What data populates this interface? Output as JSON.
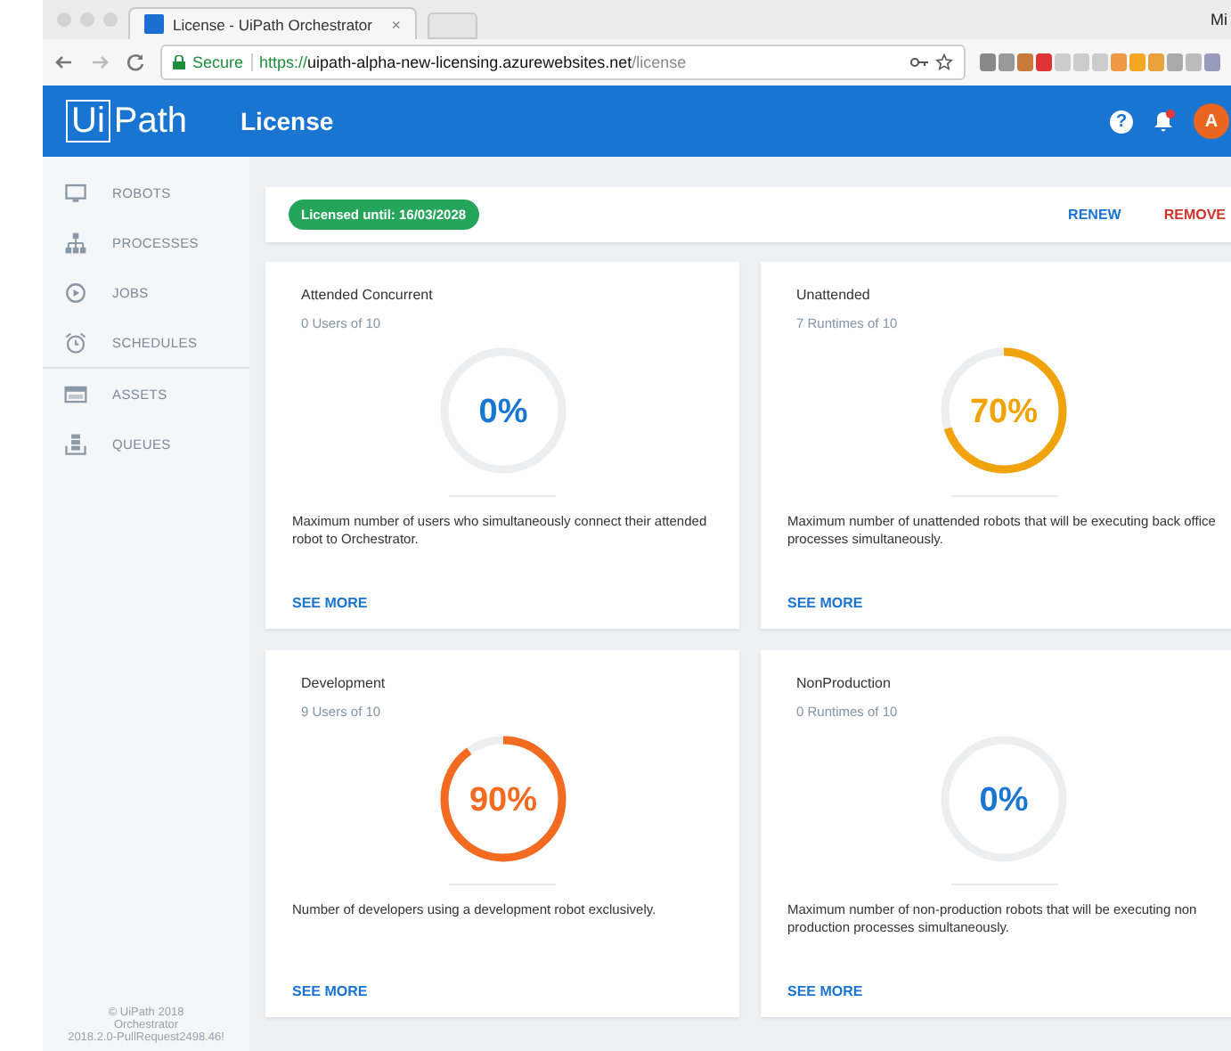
{
  "browser": {
    "tab_title": "License - UiPath Orchestrator",
    "tab_close": "×",
    "secure_label": "Secure",
    "url_scheme": "https://",
    "url_host": "uipath-alpha-new-licensing.azurewebsites.net",
    "url_path": "/license",
    "profile": "Mi"
  },
  "header": {
    "logo_left": "Ui",
    "logo_right": "Path",
    "title": "License",
    "help": "?",
    "avatar": "A",
    "notification_dot": true
  },
  "sidebar": {
    "groups": [
      {
        "items": [
          {
            "label": "ROBOTS"
          },
          {
            "label": "PROCESSES"
          },
          {
            "label": "JOBS"
          },
          {
            "label": "SCHEDULES"
          }
        ]
      },
      {
        "items": [
          {
            "label": "ASSETS"
          },
          {
            "label": "QUEUES"
          }
        ]
      }
    ],
    "footer": [
      "© UiPath 2018",
      "Orchestrator",
      "2018.2.0-PullRequest2498.46!"
    ]
  },
  "license_bar": {
    "badge": "Licensed until: 16/03/2028",
    "actions": [
      {
        "label": "RENEW",
        "kind": "primary"
      },
      {
        "label": "REMOVE",
        "kind": "danger"
      }
    ]
  },
  "cards": [
    {
      "title": "Attended Concurrent",
      "usage": "0 Users of 10",
      "percent": "0%",
      "level": 0,
      "color": "#1976d2",
      "description": "Maximum number of users who simultaneously connect their attended robot to Orchestrator.",
      "link": "SEE MORE"
    },
    {
      "title": "Unattended",
      "usage": "7 Runtimes of 10",
      "percent": "70%",
      "level": 0.7,
      "color": "#f0a30a",
      "description": "Maximum number of unattended robots that will be executing back office processes simultaneously.",
      "link": "SEE MORE"
    },
    {
      "title": "Development",
      "usage": "9 Users of 10",
      "percent": "90%",
      "level": 0.9,
      "color": "#f26b21",
      "description": "Number of developers using a development robot exclusively.",
      "link": "SEE MORE"
    },
    {
      "title": "NonProduction",
      "usage": "0 Runtimes of 10",
      "percent": "0%",
      "level": 0,
      "color": "#1976d2",
      "description": "Maximum number of non-production robots that will be executing non production processes simultaneously.",
      "link": "SEE MORE"
    }
  ]
}
